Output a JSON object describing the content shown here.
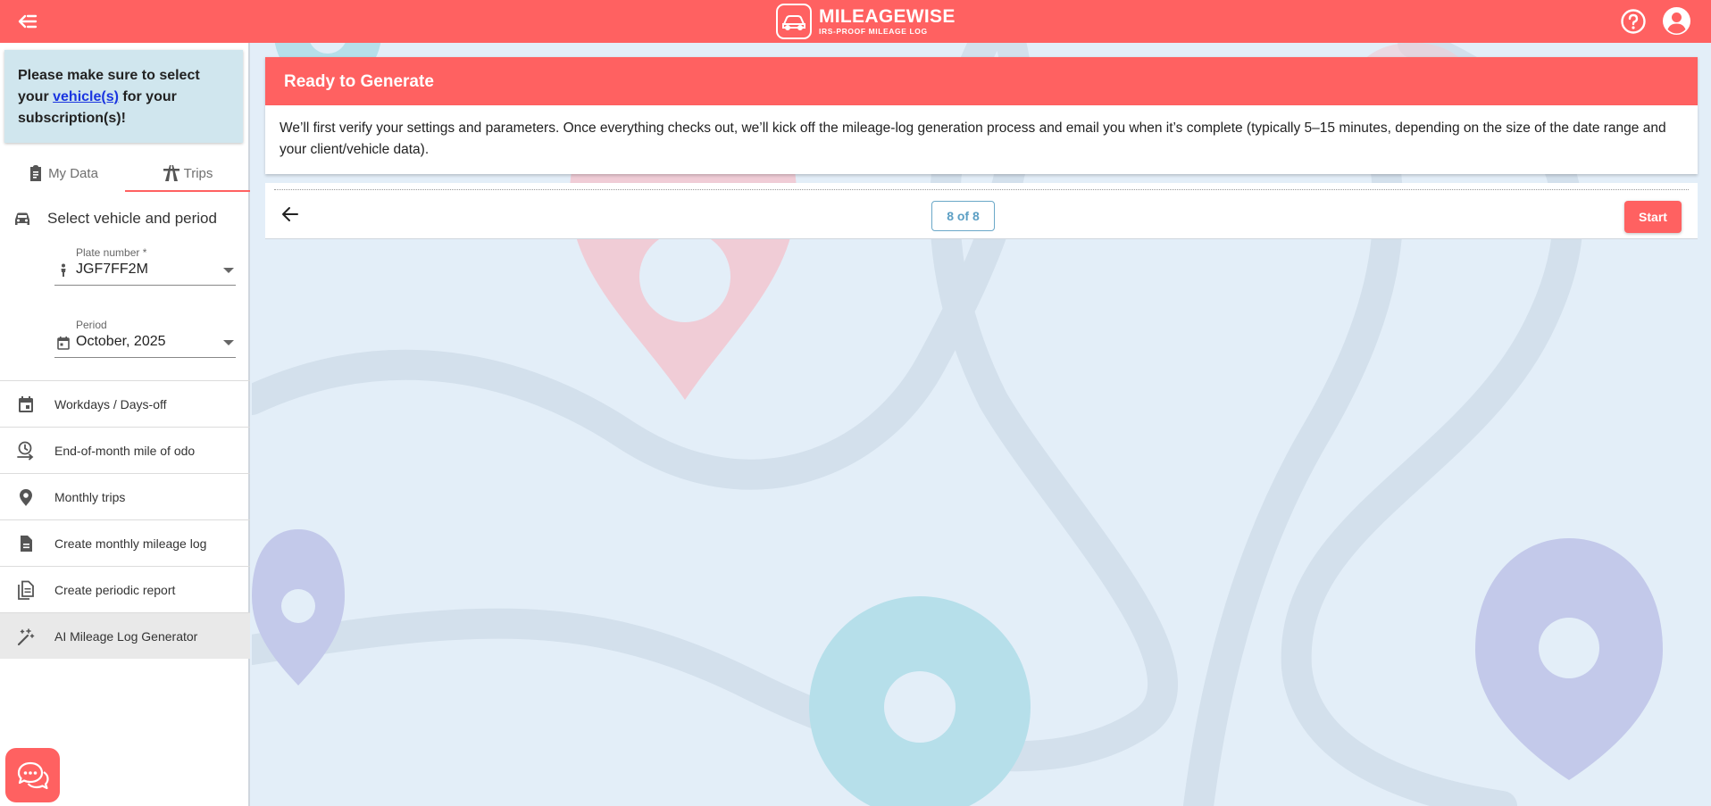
{
  "header": {
    "brand_name": "MILEAGEWISE",
    "brand_tagline": "IRS-PROOF MILEAGE LOG",
    "back_icon": "menu-collapse-icon",
    "help_icon": "help-circle-icon",
    "account_icon": "account-circle-icon",
    "accent_color": "#ff6161"
  },
  "sidebar": {
    "notice": {
      "prefix": "Please make sure to select your",
      "link": "vehicle(s)",
      "suffix": "for your subscription(s)!"
    },
    "tabs": [
      {
        "label": "My Data",
        "icon": "clipboard-icon",
        "active": false
      },
      {
        "label": "Trips",
        "icon": "road-icon",
        "active": true
      }
    ],
    "section_title": "Select vehicle and period",
    "plate": {
      "label": "Plate number *",
      "value": "JGF7FF2M"
    },
    "period": {
      "label": "Period",
      "value": "October, 2025"
    },
    "menu": [
      {
        "label": "Workdays / Days-off",
        "icon": "calendar-icon"
      },
      {
        "label": "End-of-month mile of odo",
        "icon": "clock-arrow-icon"
      },
      {
        "label": "Monthly trips",
        "icon": "map-pin-icon"
      },
      {
        "label": "Create monthly mileage log",
        "icon": "document-icon"
      },
      {
        "label": "Create periodic report",
        "icon": "documents-icon"
      },
      {
        "label": "AI Mileage Log Generator",
        "icon": "magic-wand-icon",
        "selected": true
      }
    ]
  },
  "main": {
    "card_title": "Ready to Generate",
    "card_text": "We’ll first verify your settings and parameters. Once everything checks out, we’ll kick off the mileage-log generation process and email you when it’s complete (typically 5–15 minutes, depending on the size of the date range and your client/vehicle data).",
    "step_counter": "8 of 8",
    "start_label": "Start"
  }
}
